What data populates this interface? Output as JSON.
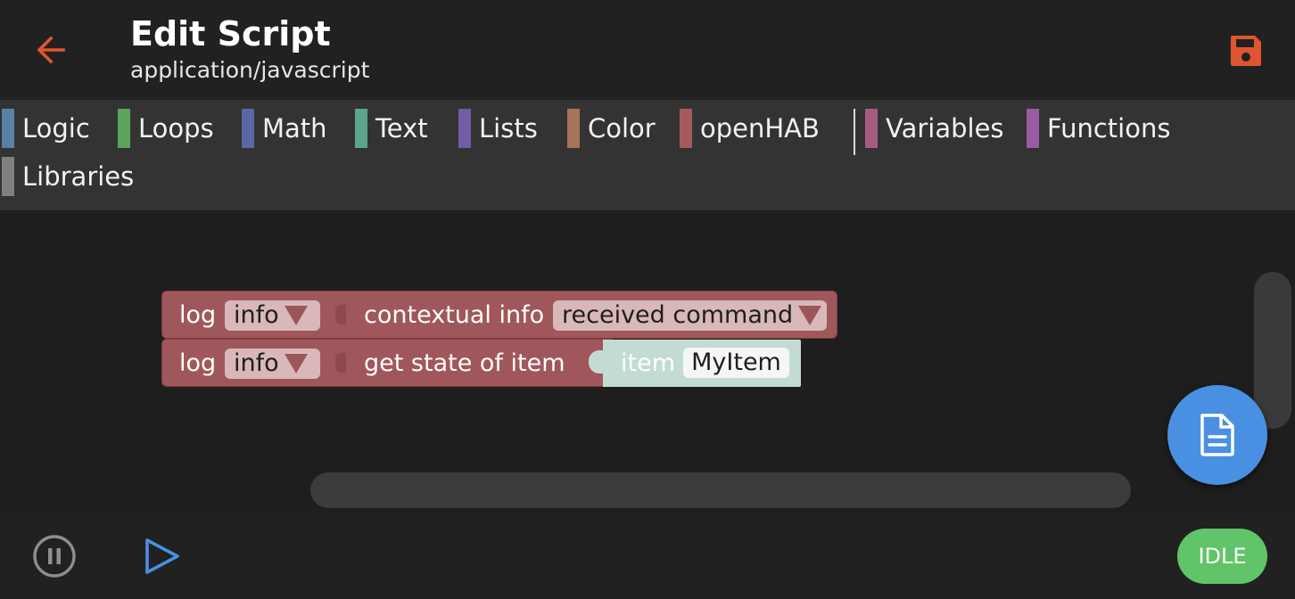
{
  "header": {
    "title": "Edit Script",
    "subtitle": "application/javascript",
    "back_icon": "arrow-left-icon",
    "save_icon": "floppy-disk-icon",
    "accent_color": "#e0552f"
  },
  "toolbox": {
    "categories": [
      {
        "label": "Logic",
        "color": "#5b80a5"
      },
      {
        "label": "Loops",
        "color": "#5ba55b"
      },
      {
        "label": "Math",
        "color": "#5b67a5"
      },
      {
        "label": "Text",
        "color": "#5ba58c"
      },
      {
        "label": "Lists",
        "color": "#745ba5"
      },
      {
        "label": "Color",
        "color": "#a5745b"
      },
      {
        "label": "openHAB",
        "color": "#a55b5b"
      },
      {
        "label": "Variables",
        "color": "#a55b80"
      },
      {
        "label": "Functions",
        "color": "#995ba5"
      },
      {
        "label": "Libraries",
        "color": "#808080"
      }
    ]
  },
  "blocks": [
    {
      "keyword": "log",
      "level": "info",
      "value_label": "contextual info",
      "value_option": "received command"
    },
    {
      "keyword": "log",
      "level": "info",
      "value_label": "get state of item",
      "item_label": "item",
      "item_value": "MyItem"
    }
  ],
  "fab": {
    "icon": "document-icon",
    "color": "#4a90e2"
  },
  "bottombar": {
    "pause_icon": "pause-icon",
    "play_icon": "play-icon",
    "status": "IDLE",
    "status_color": "#62c468"
  }
}
